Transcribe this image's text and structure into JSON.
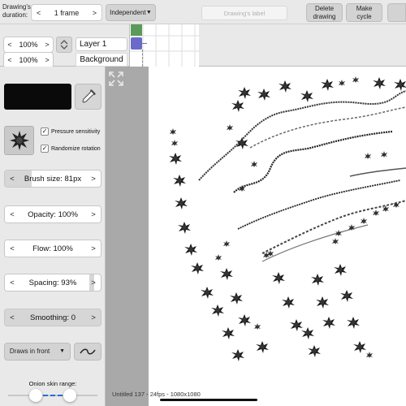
{
  "top_bar": {
    "duration_label": "Drawing's duration:",
    "frames_value": "1 frame",
    "mode_dropdown": "Independent",
    "drawing_label_placeholder": "Drawing's label",
    "delete_drawing": "Delete drawing",
    "make_cycle": "Make cycle"
  },
  "layers": {
    "layer1": {
      "opacity": "100%",
      "name": "Layer 1"
    },
    "background": {
      "opacity": "100%",
      "name": "Background"
    }
  },
  "tool_panel": {
    "pressure_sensitivity": {
      "label": "Pressure sensitivity",
      "checked": true
    },
    "randomize_rotation": {
      "label": "Randomize rotation",
      "checked": true
    },
    "brush_size": {
      "label": "Brush size:",
      "value": "81px",
      "fraction": 0.28
    },
    "opacity": {
      "label": "Opacity:",
      "value": "100%",
      "fraction": 1.0
    },
    "flow": {
      "label": "Flow:",
      "value": "100%",
      "fraction": 1.0
    },
    "spacing": {
      "label": "Spacing:",
      "value": "93%",
      "fraction": 0.93
    },
    "smoothing": {
      "label": "Smoothing:",
      "value": "0",
      "fraction": 0.0
    },
    "draws_in_front": "Draws in front",
    "onion_skin_label": "Onion skin range:"
  },
  "status_bar": "Untitled 137 - 24fps - 1080x1080",
  "colors": {
    "brush_color": "#0a0a0a",
    "timeline_green": "#5a9a5a",
    "timeline_playhead": "#6a6ac8",
    "onion_blue": "#2a6ad8"
  },
  "icons": {
    "eyedropper": "eyedropper-icon",
    "expand": "expand-icon",
    "layer_reorder": "chevron-updown-icon",
    "stroke_style": "tilde-icon"
  }
}
